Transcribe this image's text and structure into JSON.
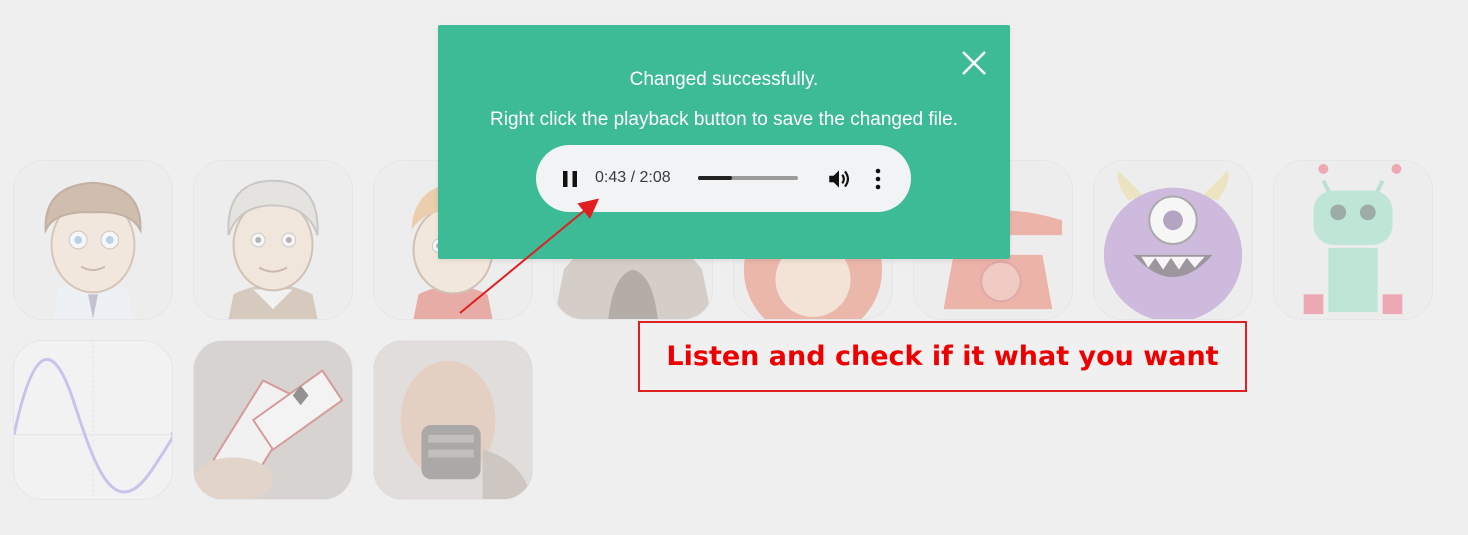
{
  "modal": {
    "message": "Changed successfully.",
    "instruction": "Right click the playback button to save the changed file.",
    "close_icon": "close-icon",
    "background_color": "#3dba96"
  },
  "player": {
    "time": "0:43 / 2:08",
    "progress": 0.336,
    "state": "playing",
    "icons": [
      "pause-icon",
      "volume-icon",
      "more-vert-icon"
    ]
  },
  "callout": {
    "text": "Listen and check if it what you want",
    "color": "#ee0000"
  },
  "voice_tiles": [
    {
      "name": "boy-avatar"
    },
    {
      "name": "old-man-avatar"
    },
    {
      "name": "child-avatar"
    },
    {
      "name": "cave"
    },
    {
      "name": "bear"
    },
    {
      "name": "telephone"
    },
    {
      "name": "monster"
    },
    {
      "name": "robot"
    },
    {
      "name": "sine-wave"
    },
    {
      "name": "cards"
    },
    {
      "name": "bane"
    }
  ]
}
